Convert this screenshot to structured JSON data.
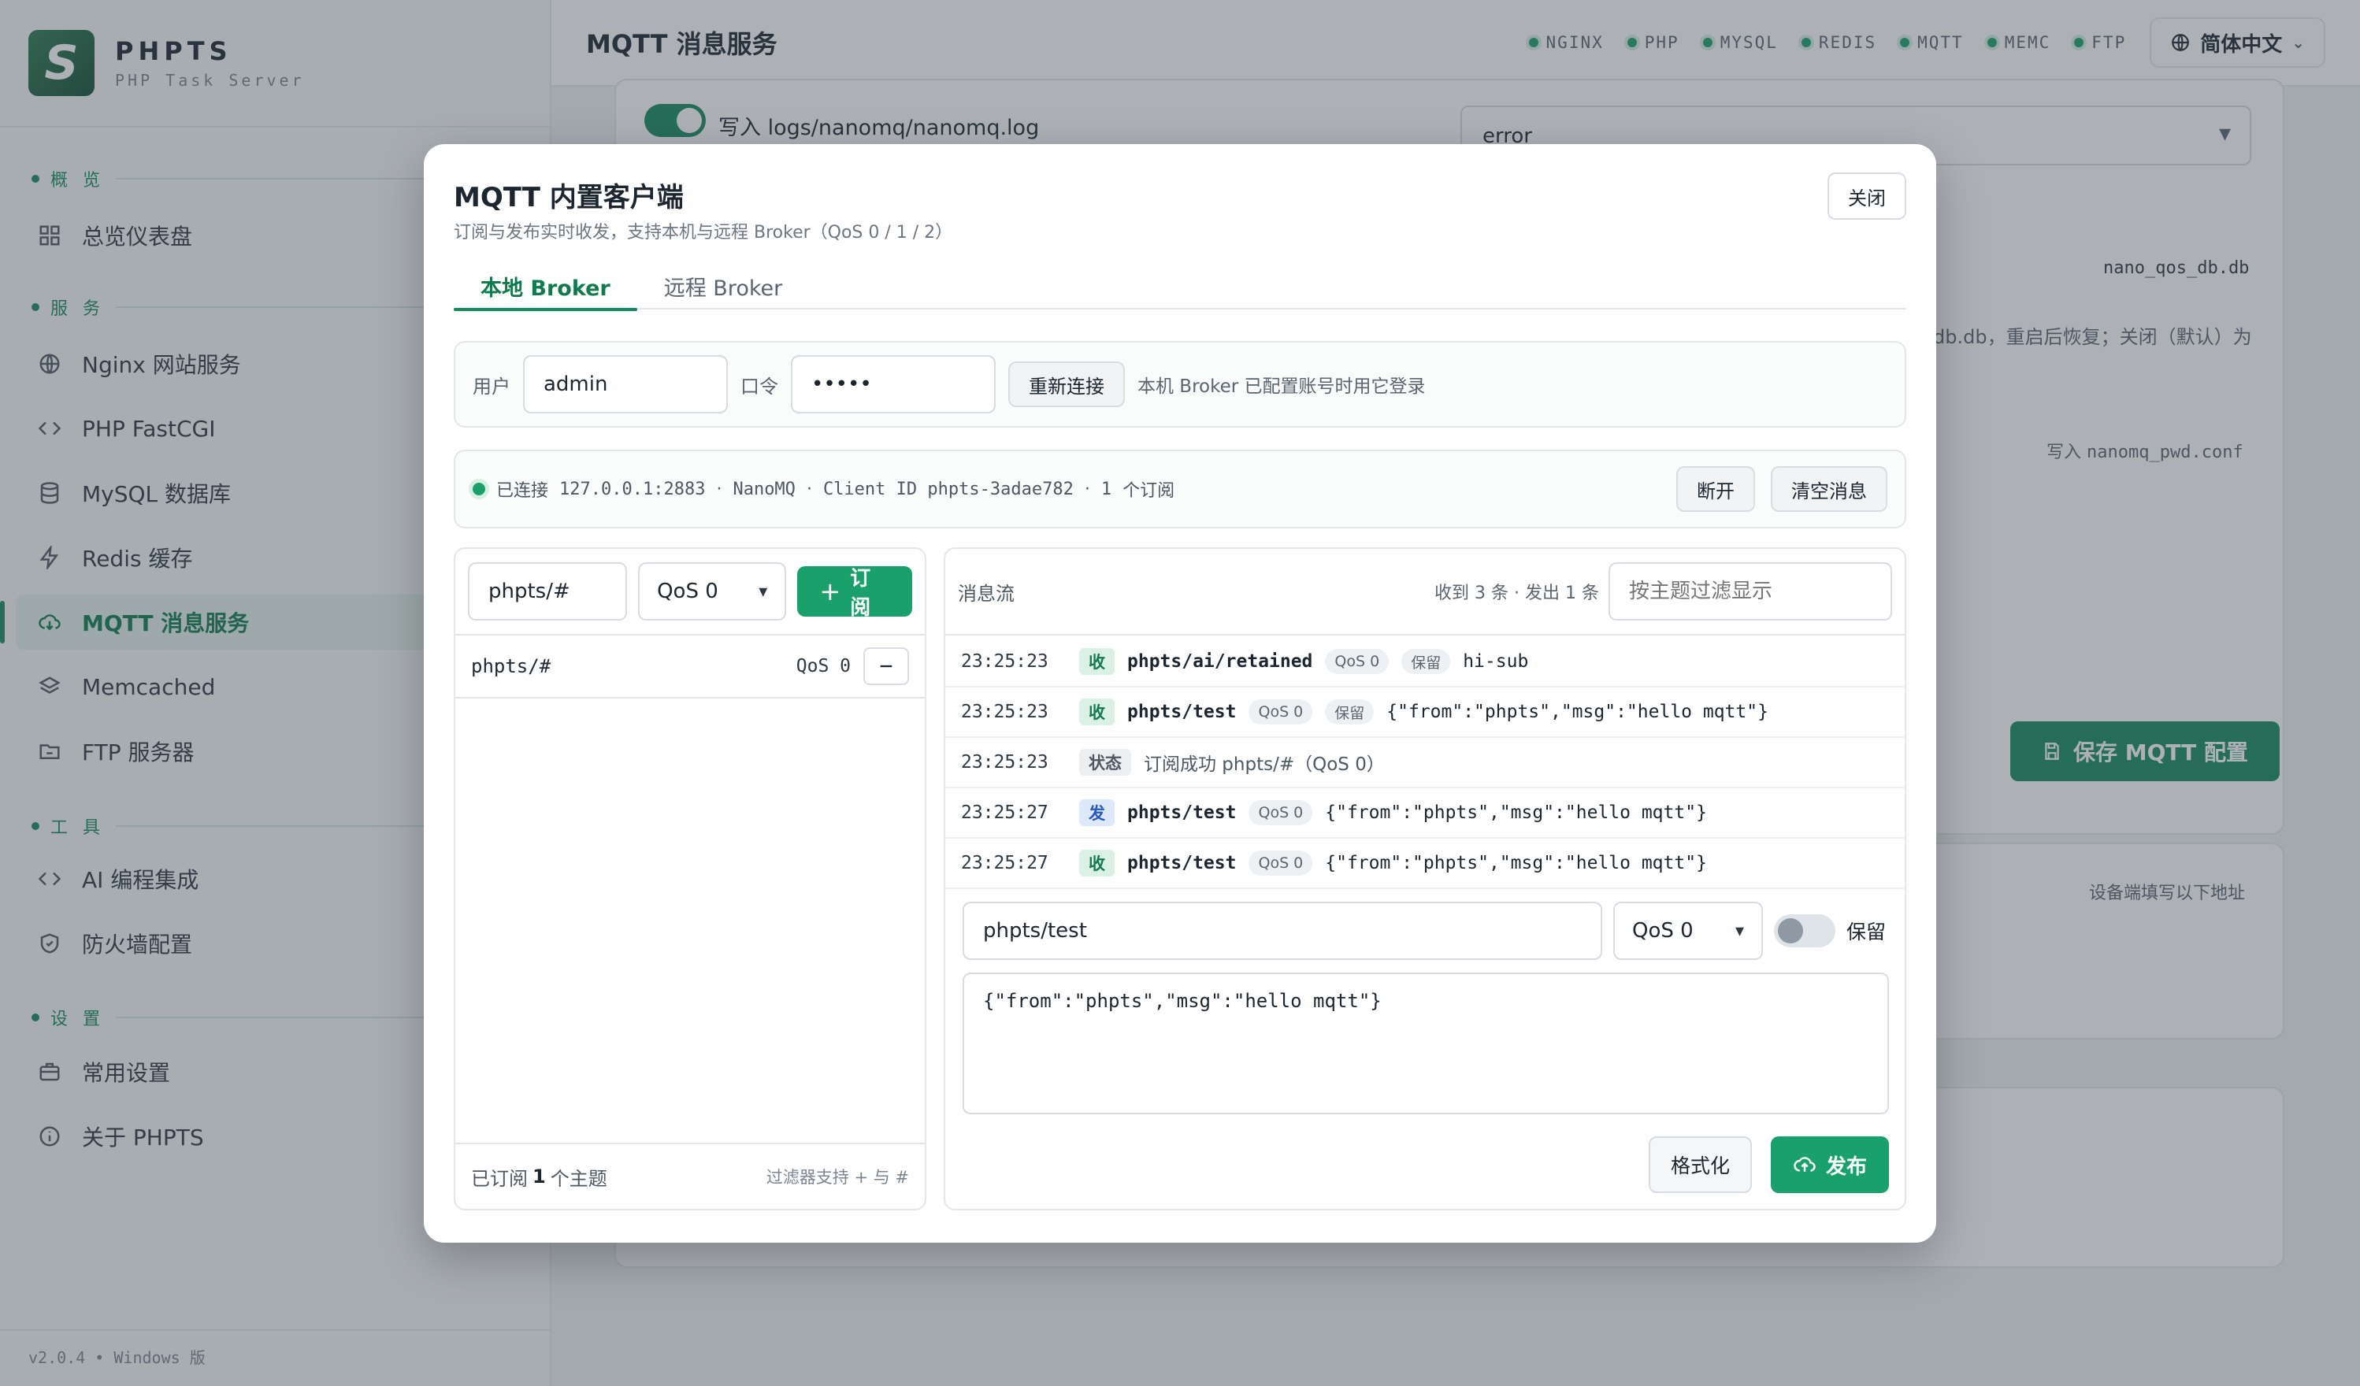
{
  "brand": {
    "name": "PHPTS",
    "subtitle": "PHP Task Server"
  },
  "sidebar": {
    "sections": [
      {
        "label": "概 览"
      },
      {
        "label": "服 务"
      },
      {
        "label": "工 具"
      },
      {
        "label": "设 置"
      }
    ],
    "items": [
      {
        "label": "总览仪表盘",
        "icon": "dashboard-icon"
      },
      {
        "label": "Nginx 网站服务",
        "icon": "globe-icon"
      },
      {
        "label": "PHP FastCGI",
        "icon": "code-icon"
      },
      {
        "label": "MySQL 数据库",
        "icon": "database-icon"
      },
      {
        "label": "Redis 缓存",
        "icon": "lightning-icon"
      },
      {
        "label": "MQTT 消息服务",
        "icon": "cloud-icon",
        "active": true
      },
      {
        "label": "Memcached",
        "icon": "layers-icon"
      },
      {
        "label": "FTP 服务器",
        "icon": "folder-icon"
      },
      {
        "label": "AI 编程集成",
        "icon": "code-icon"
      },
      {
        "label": "防火墙配置",
        "icon": "shield-icon"
      },
      {
        "label": "常用设置",
        "icon": "briefcase-icon"
      },
      {
        "label": "关于 PHPTS",
        "icon": "info-icon"
      }
    ],
    "footer": "v2.0.4 • Windows 版"
  },
  "topbar": {
    "title": "MQTT 消息服务",
    "services": [
      "NGINX",
      "PHP",
      "MYSQL",
      "REDIS",
      "MQTT",
      "MEMC",
      "FTP"
    ],
    "language": "简体中文"
  },
  "background": {
    "log_label": "写入 logs/nanomq/nanomq.log",
    "log_level": "error",
    "qos_db": "nano_qos_db.db",
    "restore_text": "db.db，重启后恢复；关闭（默认）为",
    "pwd_prefix": "写入",
    "pwd_file": "nanomq_pwd.conf",
    "save_label": "保存 MQTT 配置",
    "device_hint": "设备端填写以下地址"
  },
  "modal": {
    "title": "MQTT 内置客户端",
    "subtitle": "订阅与发布实时收发，支持本机与远程 Broker（QoS 0 / 1 / 2）",
    "close_label": "关闭",
    "tabs": [
      {
        "label": "本地 Broker",
        "active": true
      },
      {
        "label": "远程 Broker",
        "active": false
      }
    ],
    "auth": {
      "user_label": "用户",
      "user_value": "admin",
      "pass_label": "口令",
      "pass_value": "•••••",
      "reconnect_label": "重新连接",
      "hint": "本机 Broker 已配置账号时用它登录"
    },
    "status": {
      "state": "已连接",
      "address": "127.0.0.1:2883",
      "sep1": "·",
      "broker": "NanoMQ",
      "sep2": "·",
      "client_id": "Client ID phpts-3adae782",
      "sep3": "·",
      "sub_count": "1",
      "sub_suffix": "个订阅",
      "disconnect_label": "断开",
      "clear_label": "清空消息"
    },
    "subscribe": {
      "topic_value": "phpts/#",
      "qos_value": "QoS 0",
      "button_label": "订阅",
      "subscriptions": [
        {
          "topic": "phpts/#",
          "qos": "QoS 0"
        }
      ],
      "footer_prefix": "已订阅",
      "footer_count": "1",
      "footer_suffix": "个主题",
      "footer_tip": "过滤器支持 + 与 #"
    },
    "messages": {
      "label": "消息流",
      "counts": "收到 3 条 · 发出 1 条",
      "filter_placeholder": "按主题过滤显示",
      "rows": [
        {
          "time": "23:25:23",
          "kind": "收",
          "topic": "phpts/ai/retained",
          "qos": "QoS 0",
          "retained": "保留",
          "payload": "hi-sub"
        },
        {
          "time": "23:25:23",
          "kind": "收",
          "topic": "phpts/test",
          "qos": "QoS 0",
          "retained": "保留",
          "payload": "{\"from\":\"phpts\",\"msg\":\"hello mqtt\"}"
        },
        {
          "time": "23:25:23",
          "kind": "状态",
          "text": "订阅成功 phpts/#（QoS 0）"
        },
        {
          "time": "23:25:27",
          "kind": "发",
          "topic": "phpts/test",
          "qos": "QoS 0",
          "payload": "{\"from\":\"phpts\",\"msg\":\"hello mqtt\"}"
        },
        {
          "time": "23:25:27",
          "kind": "收",
          "topic": "phpts/test",
          "qos": "QoS 0",
          "payload": "{\"from\":\"phpts\",\"msg\":\"hello mqtt\"}"
        }
      ]
    },
    "publish": {
      "topic_value": "phpts/test",
      "qos_value": "QoS 0",
      "retain_label": "保留",
      "payload": "{\"from\":\"phpts\",\"msg\":\"hello mqtt\"}",
      "format_label": "格式化",
      "publish_label": "发布"
    }
  }
}
